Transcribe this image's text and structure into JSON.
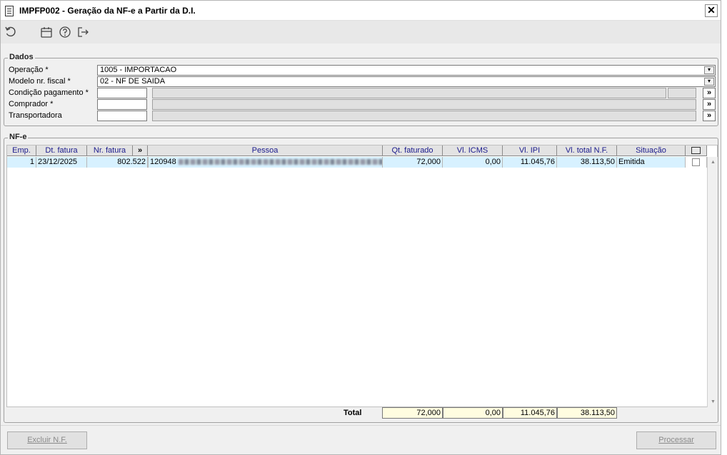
{
  "window": {
    "title": "IMPFP002 - Geração da NF-e a Partir da D.I.",
    "close_glyph": "✕"
  },
  "toolbar": {
    "icons": [
      "refresh-icon",
      "calendar-icon",
      "help-icon",
      "exit-icon"
    ]
  },
  "dados": {
    "legend": "Dados",
    "operacao": {
      "label": "Operação *",
      "value": "1005 - IMPORTACAO"
    },
    "modelo": {
      "label": "Modelo nr. fiscal *",
      "value": "02 - NF DE SAIDA"
    },
    "condicao": {
      "label": "Condição pagamento *",
      "value": ""
    },
    "comprador": {
      "label": "Comprador *",
      "value": ""
    },
    "transportadora": {
      "label": "Transportadora",
      "value": ""
    },
    "lookup_glyph": "»",
    "dropdown_glyph": "▾"
  },
  "nfe": {
    "legend": "NF-e",
    "headers": {
      "emp": "Emp.",
      "dt_fatura": "Dt. fatura",
      "nr_fatura": "Nr. fatura",
      "expand": "»",
      "pessoa": "Pessoa",
      "qt_faturado": "Qt. faturado",
      "vl_icms": "Vl. ICMS",
      "vl_ipi": "Vl. IPI",
      "vl_total": "Vl. total N.F.",
      "situacao": "Situação"
    },
    "rows": [
      {
        "emp": "1",
        "dt_fatura": "23/12/2025",
        "nr_fatura": "802.522",
        "pessoa_codigo": "120948",
        "qt_faturado": "72,000",
        "vl_icms": "0,00",
        "vl_ipi": "11.045,76",
        "vl_total": "38.113,50",
        "situacao": "Emitida"
      }
    ]
  },
  "totals": {
    "label": "Total",
    "qt_faturado": "72,000",
    "vl_icms": "0,00",
    "vl_ipi": "11.045,76",
    "vl_total": "38.113,50"
  },
  "buttons": {
    "excluir": "Excluir N.F.",
    "processar": "Processar"
  },
  "colors": {
    "row_highlight": "#d7f1ff",
    "header_text": "#1a1a8c",
    "total_bg": "#fffde0"
  }
}
